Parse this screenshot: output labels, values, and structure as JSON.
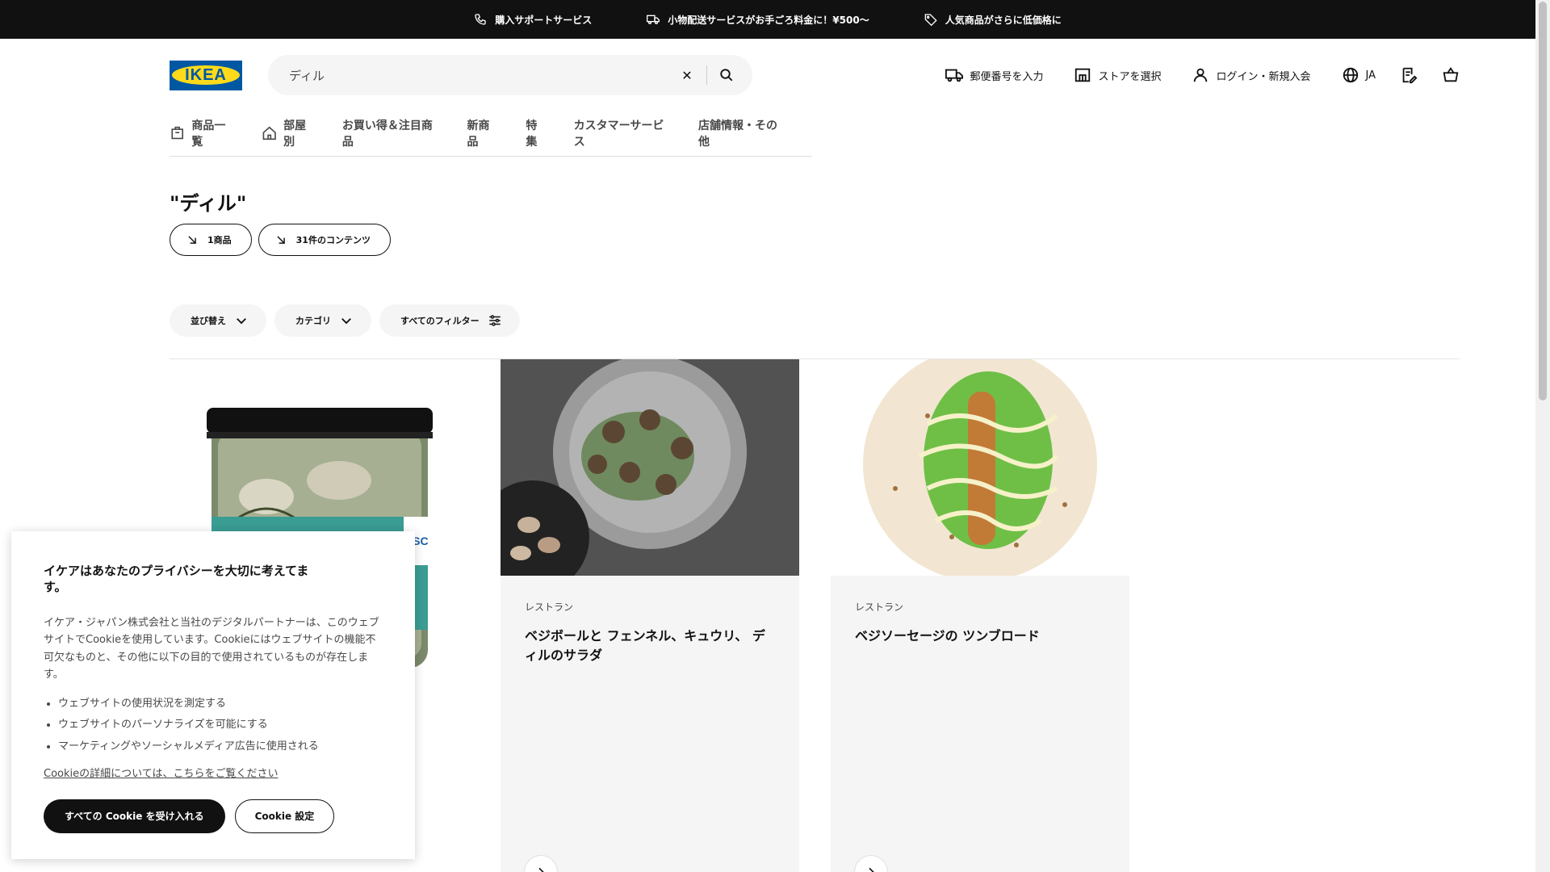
{
  "topbar": {
    "items": [
      {
        "icon": "phone-icon",
        "label": "購入サポートサービス"
      },
      {
        "icon": "truck-icon",
        "label": "小物配送サービスがお手ごろ料金に！¥500〜"
      },
      {
        "icon": "tag-icon",
        "label": "人気商品がさらに低価格に"
      }
    ]
  },
  "header": {
    "logo_text": "IKEA",
    "search_value": "ディル",
    "postal_label": "郵便番号を入力",
    "store_label": "ストアを選択",
    "login_label": "ログイン・新規入会",
    "language_label": "JA"
  },
  "nav": {
    "items": [
      {
        "label": "商品一覧",
        "icon": "box-icon"
      },
      {
        "label": "部屋別",
        "icon": "home-icon"
      },
      {
        "label": "お買い得＆注目商品"
      },
      {
        "label": "新商品"
      },
      {
        "label": "特集"
      },
      {
        "label": "カスタマーサービス"
      },
      {
        "label": "店舗情報・その他"
      }
    ]
  },
  "results": {
    "title": "\"ディル\"",
    "chips": [
      "1商品",
      "31件のコンテンツ"
    ]
  },
  "filters": {
    "sort_label": "並び替え",
    "category_label": "カテゴリ",
    "all_filters_label": "すべてのフィルター"
  },
  "cards": [
    {
      "category": "レストラン",
      "title": "ベジボールと フェンネル、キュウリ、 ディルのサラダ"
    },
    {
      "category": "レストラン",
      "title": "ベジソーセージの ツンブロード"
    }
  ],
  "cookie": {
    "title": "イケアはあなたのプライバシーを大切に考えてます。",
    "text": "イケア・ジャパン株式会社と当社のデジタルパートナーは、このウェブサイトでCookieを使用しています。Cookieにはウェブサイトの機能不可欠なものと、その他に以下の目的で使用されているものが存在します。",
    "bullets": [
      "ウェブサイトの使用状況を測定する",
      "ウェブサイトのパーソナライズを可能にする",
      "マーケティングやソーシャルメディア広告に使用される"
    ],
    "link": "Cookieの詳細については、こちらをご覧ください",
    "accept_label": "すべての Cookie を受け入れる",
    "settings_label": "Cookie 設定"
  }
}
